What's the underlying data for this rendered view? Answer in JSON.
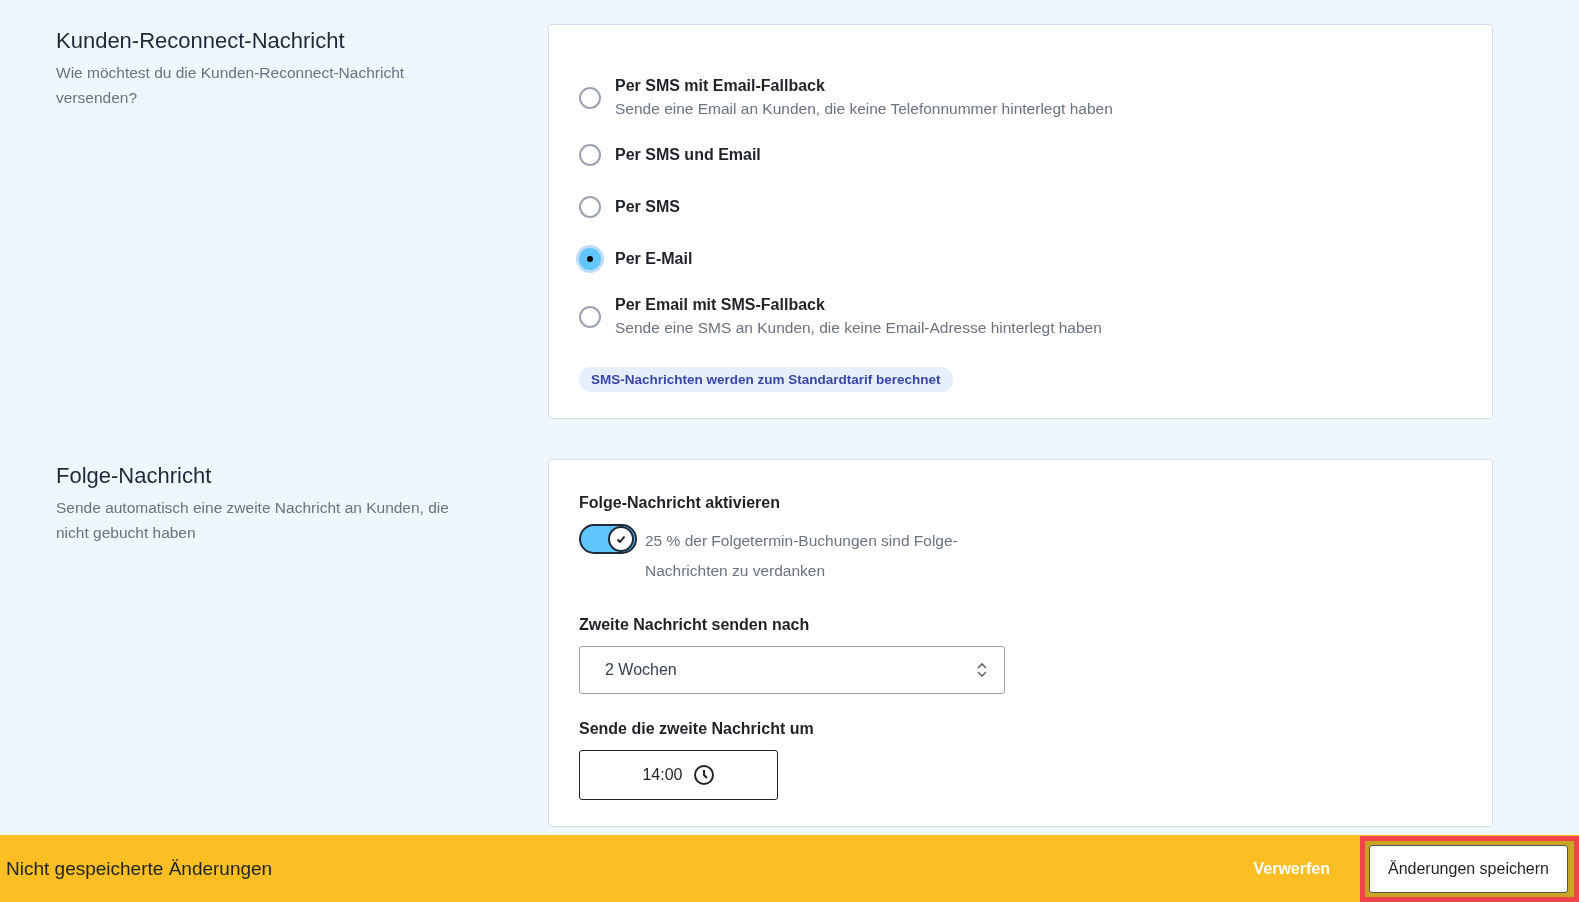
{
  "sections": [
    {
      "kind": "radio_group",
      "title": "Kunden-Reconnect-Nachricht",
      "description": "Wie möchtest du die Kunden-Reconnect-Nachricht versenden?",
      "options": [
        {
          "label": "Per SMS mit Email-Fallback",
          "hint": "Sende eine Email an Kunden, die keine Telefonnummer hinterlegt haben",
          "selected": false
        },
        {
          "label": "Per SMS und Email",
          "selected": false
        },
        {
          "label": "Per SMS",
          "selected": false
        },
        {
          "label": "Per E-Mail",
          "selected": true
        },
        {
          "label": "Per Email mit SMS-Fallback",
          "hint": "Sende eine SMS an Kunden, die keine Email-Adresse hinterlegt haben",
          "selected": false
        }
      ],
      "notice": "SMS-Nachrichten werden zum Standardtarif berechnet"
    },
    {
      "kind": "followup",
      "title": "Folge-Nachricht",
      "description": "Sende automatisch eine zweite Nachricht an Kunden, die nicht gebucht haben",
      "toggle": {
        "label": "Folge-Nachricht aktivieren",
        "on": true,
        "text": "25 % der Folgetermin-Buchungen sind Folge-Nachrichten zu verdanken"
      },
      "delay": {
        "label": "Zweite Nachricht senden nach",
        "value": "2 Wochen"
      },
      "time": {
        "label": "Sende die zweite Nachricht um",
        "value": "14:00"
      }
    }
  ],
  "footer": {
    "message": "Nicht gespeicherte Änderungen",
    "discard": "Verwerfen",
    "save": "Änderungen speichern"
  }
}
